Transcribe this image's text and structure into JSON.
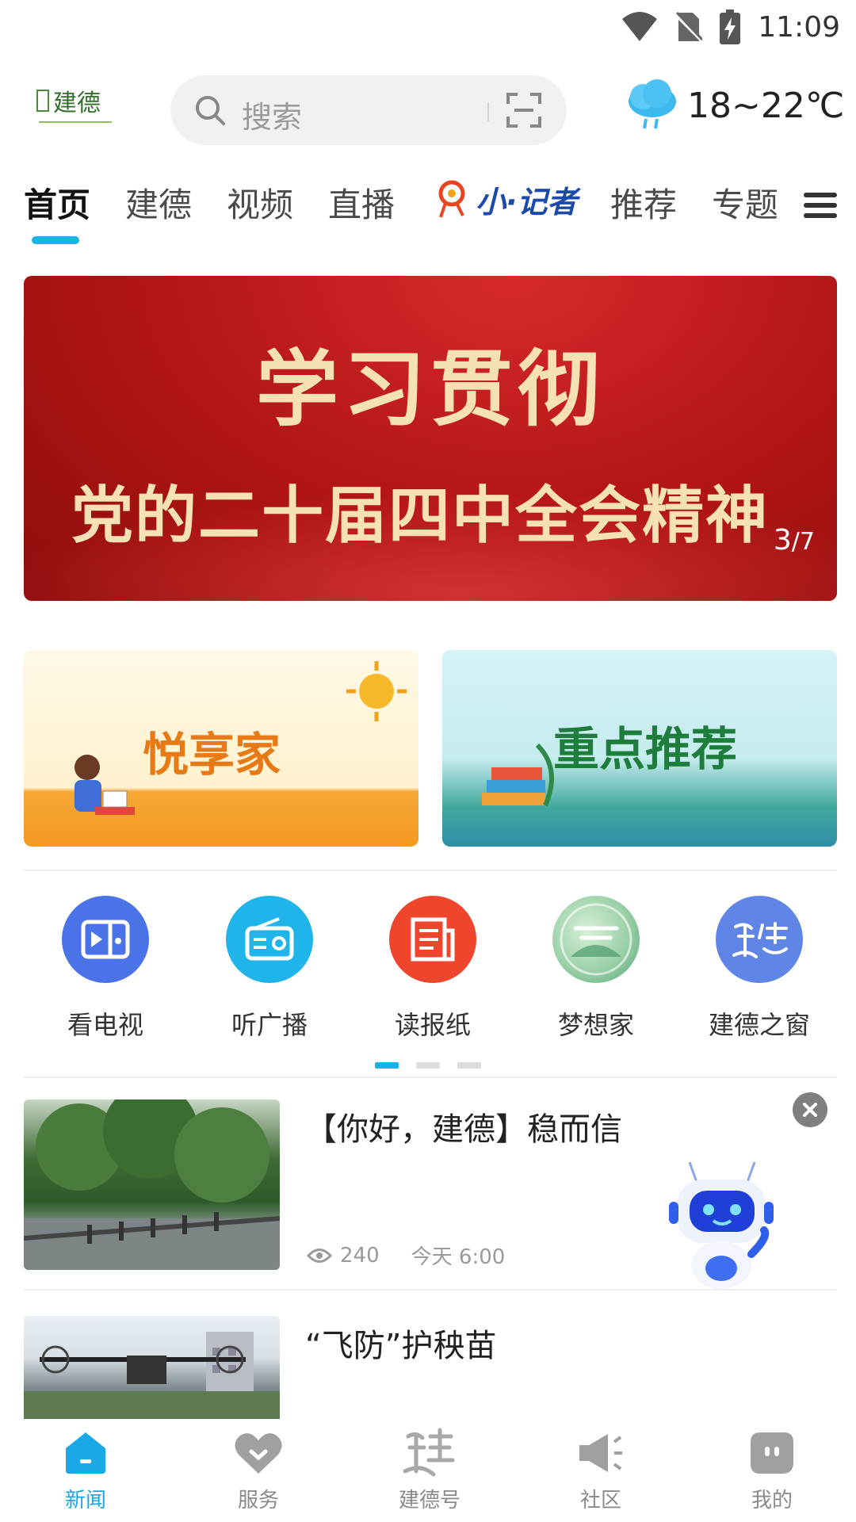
{
  "status_bar": {
    "time": "11:09"
  },
  "header": {
    "search_placeholder": "搜索",
    "weather": "18~22℃"
  },
  "tabs": [
    "首页",
    "建德",
    "视频",
    "直播",
    "小·记者",
    "推荐",
    "专题"
  ],
  "active_tab": "首页",
  "banner": {
    "line1": "学习贯彻",
    "line2": "党的二十届四中全会精神",
    "page_current": "3",
    "page_total": "/7"
  },
  "cards": [
    {
      "title": "悦享家"
    },
    {
      "title": "重点推荐"
    }
  ],
  "quick_links": [
    {
      "label": "看电视",
      "icon": "tv-icon",
      "color": "#4a73e8"
    },
    {
      "label": "听广播",
      "icon": "radio-icon",
      "color": "#1fb4ea"
    },
    {
      "label": "读报纸",
      "icon": "newspaper-icon",
      "color": "#f0452d"
    },
    {
      "label": "梦想家",
      "icon": "dreamer-icon",
      "color": "#6fb58d"
    },
    {
      "label": "建德之窗",
      "icon": "jiande-window-icon",
      "color": "#5f86e6"
    }
  ],
  "news": [
    {
      "title": "【你好，建德】稳而信",
      "views": "240",
      "time": "今天 6:00"
    },
    {
      "title": "“飞防”护秧苗"
    }
  ],
  "bottom_nav": [
    {
      "label": "新闻",
      "icon": "home-icon"
    },
    {
      "label": "服务",
      "icon": "heart-icon"
    },
    {
      "label": "建德号",
      "icon": "jiande-calligraphy-icon"
    },
    {
      "label": "社区",
      "icon": "megaphone-icon"
    },
    {
      "label": "我的",
      "icon": "profile-icon"
    }
  ],
  "colors": {
    "accent": "#18b4e8",
    "banner_red": "#b01414",
    "banner_text": "#f6e1b4"
  }
}
